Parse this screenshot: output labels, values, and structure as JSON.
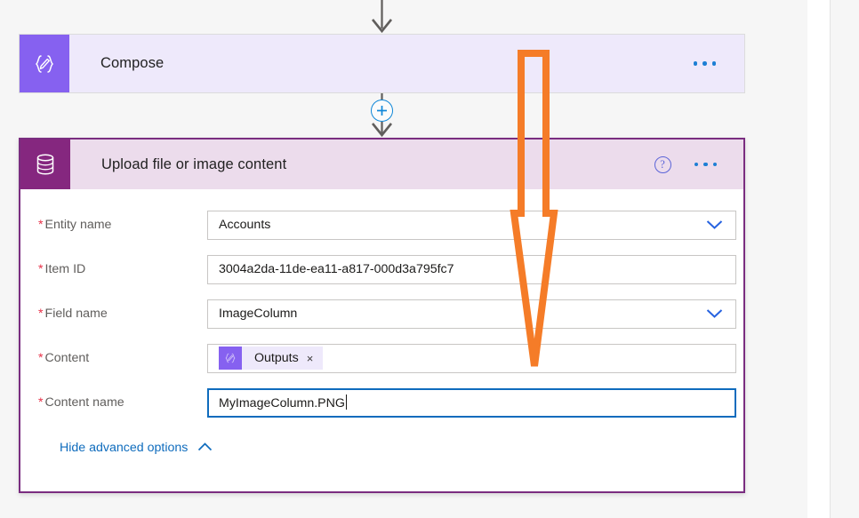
{
  "flow": {
    "compose_step": {
      "title": "Compose",
      "icon": "compose-braces-pencil-icon",
      "overflow_label": "...",
      "accent_color": "#8661f0",
      "body_color": "#eee9fb"
    },
    "add_step_button": {
      "icon": "plus-icon",
      "color": "#0f87d8"
    },
    "upload_step": {
      "title": "Upload file or image content",
      "icon": "database-cylinder-icon",
      "help_label": "?",
      "overflow_label": "...",
      "accent_color": "#85277f",
      "header_color": "#ecdcec",
      "border_color": "#7a2d80"
    }
  },
  "form": {
    "required_marker": "*",
    "fields": [
      {
        "label": "Entity name",
        "value": "Accounts",
        "type": "dropdown",
        "icon": "chevron-down-icon",
        "focused": false
      },
      {
        "label": "Item ID",
        "value": "3004a2da-11de-ea11-a817-000d3a795fc7",
        "type": "text",
        "icon": "",
        "focused": false
      },
      {
        "label": "Field name",
        "value": "ImageColumn",
        "type": "dropdown",
        "icon": "chevron-down-icon",
        "focused": false
      },
      {
        "label": "Content",
        "value": "",
        "type": "token",
        "icon": "",
        "focused": false,
        "token": {
          "label": "Outputs",
          "icon": "compose-braces-pencil-icon",
          "remove_label": "×"
        }
      },
      {
        "label": "Content name",
        "value": "MyImageColumn.PNG",
        "type": "text",
        "icon": "",
        "focused": true
      }
    ],
    "advanced_options": {
      "label": "Hide advanced options",
      "icon": "chevron-up-icon"
    }
  },
  "annotation": {
    "shape": "hand-drawn-down-arrow",
    "color": "#f57c28",
    "points_to": "Content field"
  }
}
